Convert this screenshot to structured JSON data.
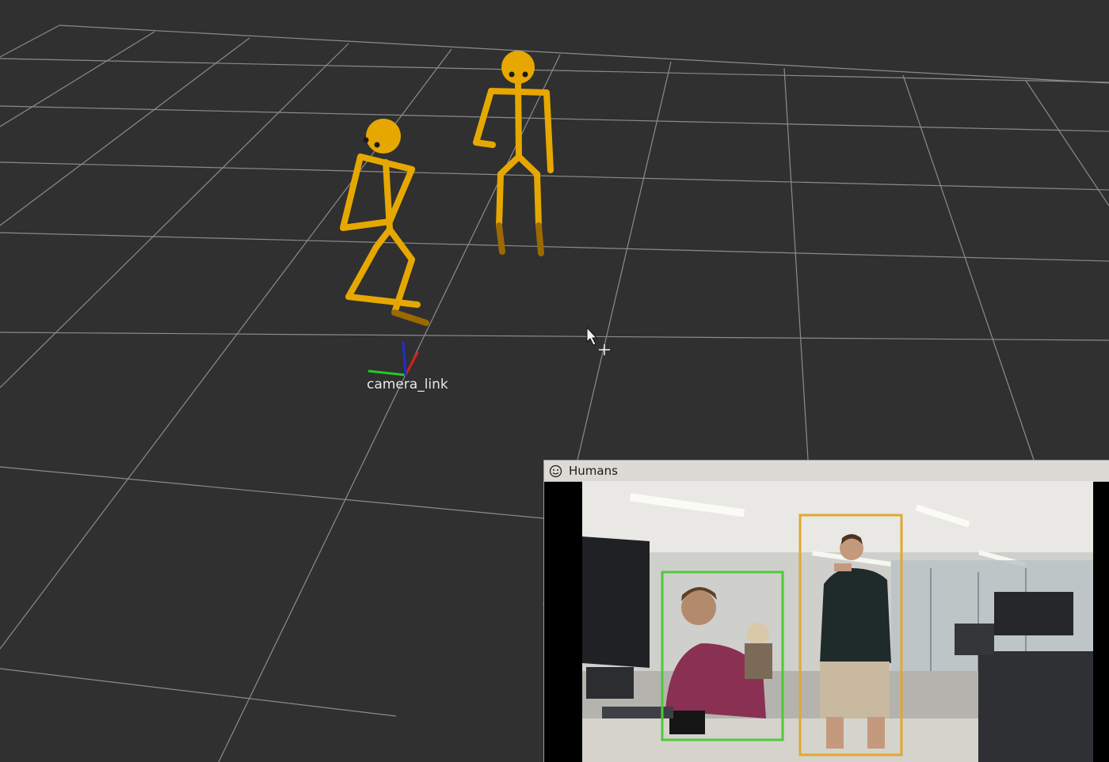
{
  "scene": {
    "background_color": "#303030",
    "grid_color": "#a0a0a0",
    "skeleton_color": "#e6a800",
    "frame_label": "camera_link",
    "axes_colors": {
      "x": "#cc1f1f",
      "y": "#22cc22",
      "z": "#1f2fcc"
    },
    "cursor_icon": "move-cursor-icon"
  },
  "panel": {
    "title": "Humans",
    "icon": "smiley-icon",
    "detections": [
      {
        "box_color": "#4ec93a"
      },
      {
        "box_color": "#e0a830"
      }
    ]
  }
}
